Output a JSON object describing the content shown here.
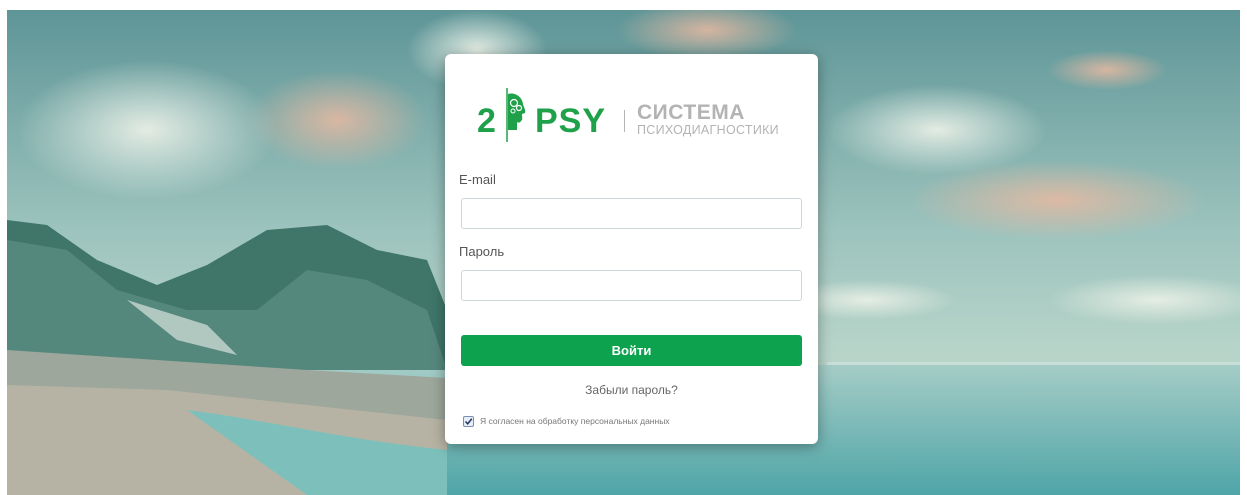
{
  "brand": {
    "logo_number": "2",
    "logo_name": "PSY",
    "logo_title": "СИСТЕМА",
    "logo_subtitle": "ПСИХОДИАГНОСТИКИ",
    "color": "#1fa14a"
  },
  "form": {
    "email_label": "E-mail",
    "email_value": "",
    "password_label": "Пароль",
    "password_value": "",
    "submit_label": "Войти",
    "submit_color": "#0da24e",
    "forgot_link": "Забыли пароль?",
    "consent_label": "Я согласен на обработку персональных данных",
    "consent_checked": true
  },
  "icons": {
    "head": "head-gears-icon",
    "check": "checkmark-icon"
  }
}
